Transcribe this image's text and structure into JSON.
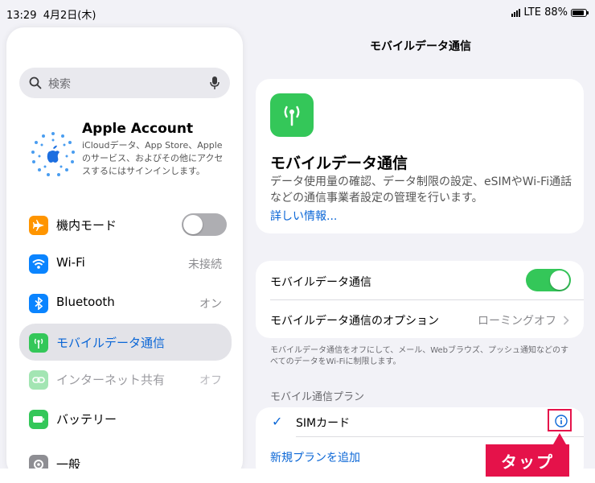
{
  "status_bar": {
    "time": "13:29",
    "date": "4月2日(木)",
    "network": "LTE 88%"
  },
  "sidebar": {
    "search_placeholder": "検索",
    "account": {
      "title": "Apple Account",
      "subtitle": "iCloudデータ、App Store、Appleのサービス、およびその他にアクセスするにはサインインします。"
    },
    "items": [
      {
        "label": "機内モード",
        "value": "",
        "icon": "airplane-icon",
        "color": "#ff9500"
      },
      {
        "label": "Wi-Fi",
        "value": "未接続",
        "icon": "wifi-icon",
        "color": "#0a84ff"
      },
      {
        "label": "Bluetooth",
        "value": "オン",
        "icon": "bluetooth-icon",
        "color": "#0a84ff"
      },
      {
        "label": "モバイルデータ通信",
        "value": "",
        "icon": "antenna-icon",
        "color": "#34c759"
      },
      {
        "label": "インターネット共有",
        "value": "オフ",
        "icon": "link-icon",
        "color": "#34c759"
      },
      {
        "label": "バッテリー",
        "value": "",
        "icon": "battery-icon",
        "color": "#34c759"
      },
      {
        "label": "一般",
        "value": "",
        "icon": "gear-icon",
        "color": "#8e8e93"
      }
    ]
  },
  "detail": {
    "nav_title": "モバイルデータ通信",
    "hero": {
      "title": "モバイルデータ通信",
      "description": "データ使用量の確認、データ制限の設定、eSIMやWi-Fi通話などの通信事業者設定の管理を行います。",
      "link": "詳しい情報..."
    },
    "main_toggle_label": "モバイルデータ通信",
    "options_label": "モバイルデータ通信のオプション",
    "options_value": "ローミングオフ",
    "footnote": "モバイルデータ通信をオフにして、メール、Webブラウズ、プッシュ通知などのすべてのデータをWi-Fiに制限します。",
    "plans_header": "モバイル通信プラン",
    "plan_label": "SIMカード",
    "add_plan": "新規プランを追加"
  },
  "annotation": {
    "tap": "タップ",
    "color": "#e5124a"
  },
  "colors": {
    "accent": "#0a66d6",
    "toggle_on": "#34c759",
    "toggle_off": "#aeaeb2"
  }
}
